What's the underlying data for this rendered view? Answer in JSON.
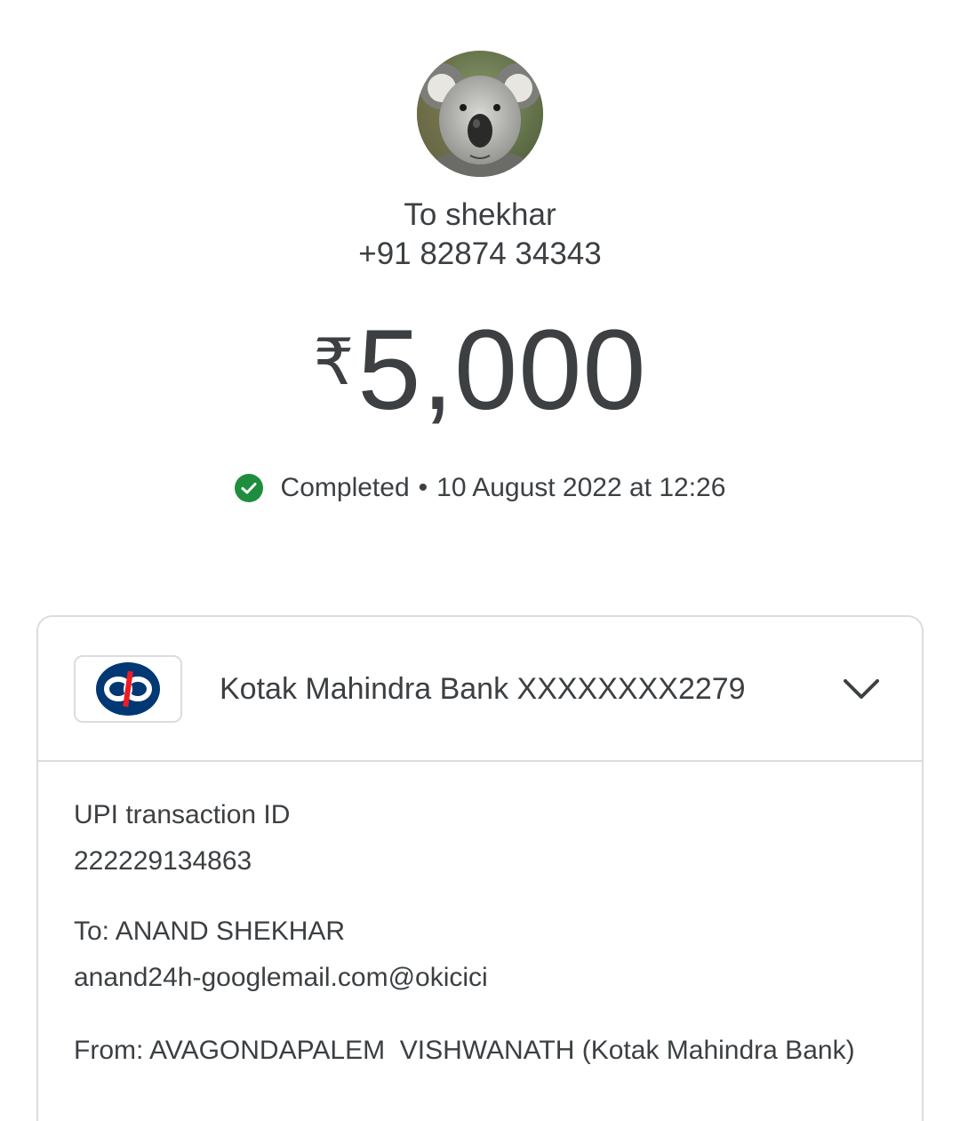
{
  "recipient": {
    "name": "To shekhar",
    "phone": "+91 82874 34343"
  },
  "payment": {
    "currency_symbol": "₹",
    "amount": "5,000",
    "status": "Completed",
    "separator": "•",
    "datetime": "10 August 2022 at 12:26"
  },
  "account": {
    "bank_label": "Kotak Mahindra Bank XXXXXXXX2279"
  },
  "details": {
    "upi_label": "UPI transaction ID",
    "upi_id": "222229134863",
    "to_label": "To: ANAND SHEKHAR",
    "to_upi": "anand24h-googlemail.com@okicici",
    "from_label": "From: AVAGONDAPALEM  VISHWANATH (Kotak Mahindra Bank)"
  },
  "icons": {
    "status": "check-circle-icon",
    "expand": "chevron-down-icon",
    "bank_logo": "kotak-logo-icon"
  },
  "colors": {
    "text": "#3c4043",
    "success": "#1e8e3e",
    "kotak_blue": "#003874",
    "kotak_red": "#ed1c24",
    "border": "#dadce0"
  }
}
